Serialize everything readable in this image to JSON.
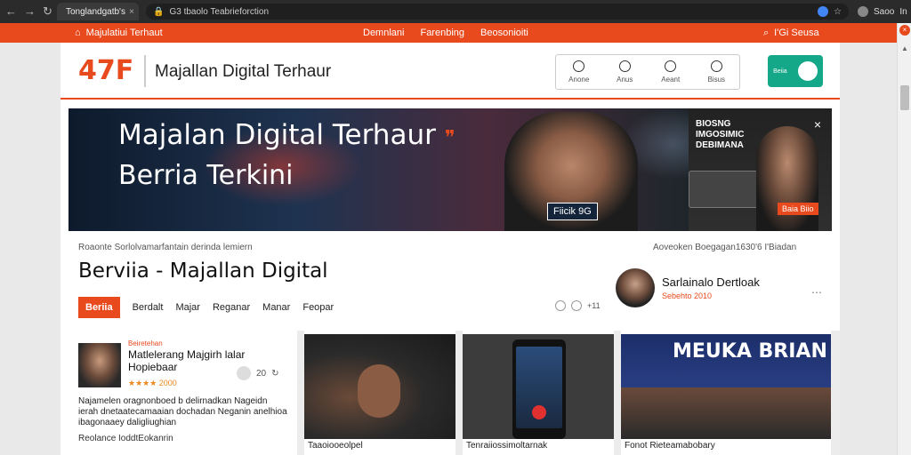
{
  "browser": {
    "tab_title": "Tonglandgatb's",
    "tab_close": "×",
    "url": "G3 tbaolo Teabrieforction",
    "profile_label": "Saoo",
    "menu_label": "In"
  },
  "topnav": {
    "home_label": "Majulatiui Terhaut",
    "links": [
      "Demnlani",
      "Farenbing",
      "Beosonioiti"
    ],
    "search_label": "I'Gi Seusa"
  },
  "site": {
    "logo": "47F",
    "title": "Majallan Digital Terhaur"
  },
  "iconbar": {
    "items": [
      {
        "label": "Anone",
        "icon": "info-icon"
      },
      {
        "label": "Anus",
        "icon": "search-icon"
      },
      {
        "label": "Aeant",
        "icon": "settings-icon"
      },
      {
        "label": "Bisus",
        "icon": "user-icon"
      }
    ]
  },
  "app_button": {
    "label": "Beiia",
    "icon": "app-icon"
  },
  "hero": {
    "headline_1": "Majalan Digital Terhaur",
    "quote_mark": "❞",
    "headline_2": "Berria Terkini",
    "caption": "Fiicik 9G",
    "side_title": "BIOSNG IMGOSIMIC DEBIMANA",
    "side_close": "×",
    "side_tag": "Baia Biio"
  },
  "article": {
    "meta_left": "Roaonte  Sorlolvamarfantain derinda lemiern",
    "meta_right": "Aoveoken    Boegagan1630'6 I'Biadan",
    "title": "Berviia - Majallan Digital",
    "categories": [
      "Beriia",
      "Berdalt",
      "Majar",
      "Reganar",
      "Manar",
      "Feopar"
    ],
    "share_count": "+11"
  },
  "author": {
    "name": "Sarlainalo Dertloak",
    "date": "Sebehto 2010",
    "more": "⋯"
  },
  "cards": {
    "featured": {
      "kicker": "Beiretehan",
      "headline": "Matlelerang Majgirh lalar Hopiebaar",
      "rating": "★★★★ 2000",
      "count": "20",
      "body": "Najamelen oragnonboed b delirnadkan Nageidn ierah dnetaatecamaaian dochadan Neganin anelhioa ibagonaaey daligliughian",
      "footer": "Reolance  IoddtEokanrin"
    },
    "card2_caption": "Taaoiooeolpel",
    "card3_caption": "Tenraiiossimoltarnak",
    "card4_caption": "Fonot Rieteamabobary",
    "card4_banner": "MEUKA BRIAN"
  },
  "colors": {
    "accent": "#e8491d",
    "app_green": "#14a888"
  }
}
